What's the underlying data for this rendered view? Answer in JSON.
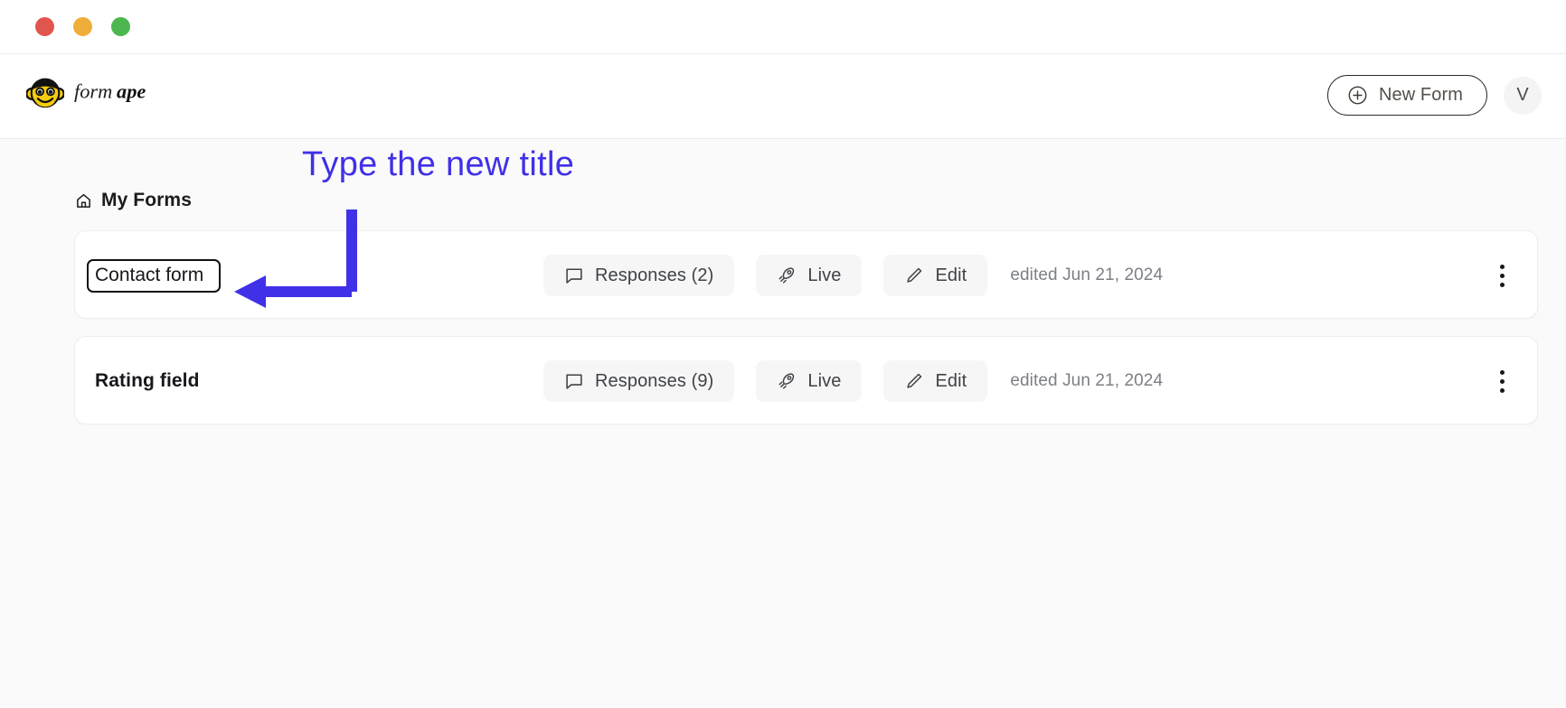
{
  "window": {
    "controls": [
      {
        "name": "close",
        "color": "#e0564f"
      },
      {
        "name": "minimize",
        "color": "#efad3a"
      },
      {
        "name": "maximize",
        "color": "#4cb74f"
      }
    ]
  },
  "header": {
    "brand_name": "formape",
    "brand_word_primary": "form",
    "brand_word_secondary": "ape",
    "brand_icon": "monkey-face-logo",
    "new_form_label": "New Form",
    "new_form_icon": "plus-circle-icon",
    "avatar_initial": "V"
  },
  "main": {
    "breadcrumb_icon": "home-icon",
    "breadcrumb_label": "My Forms",
    "forms": [
      {
        "title": "Contact form",
        "title_editing": true,
        "responses_label": "Responses (2)",
        "responses_icon": "message-square-icon",
        "live_label": "Live",
        "live_icon": "rocket-icon",
        "edit_label": "Edit",
        "edit_icon": "pencil-icon",
        "edited_label": "edited Jun 21, 2024",
        "menu_icon": "kebab-menu-icon"
      },
      {
        "title": "Rating field",
        "title_editing": false,
        "responses_label": "Responses (9)",
        "responses_icon": "message-square-icon",
        "live_label": "Live",
        "live_icon": "rocket-icon",
        "edit_label": "Edit",
        "edit_icon": "pencil-icon",
        "edited_label": "edited Jun 21, 2024",
        "menu_icon": "kebab-menu-icon"
      }
    ]
  },
  "annotation": {
    "text": "Type the new title",
    "color": "#4030e8",
    "arrow_icon": "elbow-arrow-left-icon"
  },
  "colors": {
    "page_background": "#fafafa",
    "card_background": "#ffffff",
    "accent_annotation": "#4030e8",
    "pill_background": "#f6f6f7",
    "brand_yellow": "#f5cc0e",
    "text_primary": "#17181b",
    "text_muted": "#7c7f85"
  }
}
